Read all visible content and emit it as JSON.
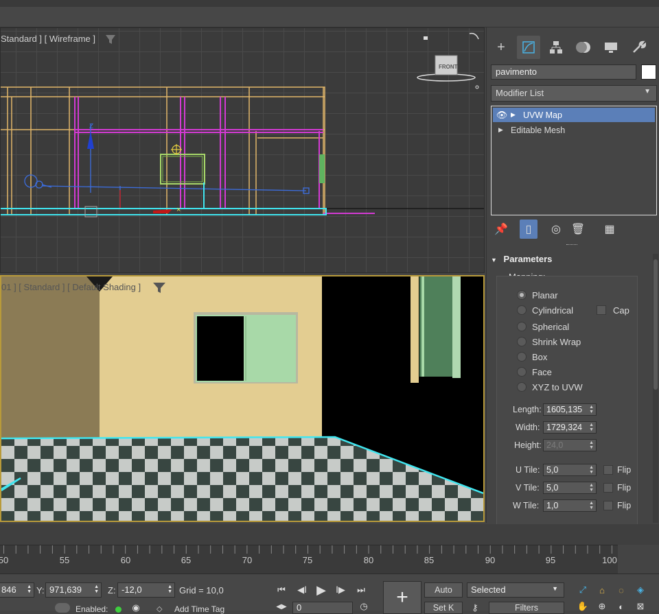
{
  "viewport_top": {
    "label": "Standard ] [ Wireframe ]",
    "viewcube_label": "FRONT"
  },
  "viewport_persp": {
    "label": "01 ] [ Standard ] [ Default Shading ]"
  },
  "command_panel": {
    "object_name": "pavimento",
    "object_color": "#ffffff",
    "modifier_list_label": "Modifier List",
    "stack": [
      {
        "label": "UVW Map",
        "selected": true
      },
      {
        "label": "Editable Mesh",
        "selected": false
      }
    ],
    "parameters": {
      "title": "Parameters",
      "mapping_label": "Mapping:",
      "options": [
        "Planar",
        "Cylindrical",
        "Spherical",
        "Shrink Wrap",
        "Box",
        "Face",
        "XYZ to UVW"
      ],
      "selected_option": "Planar",
      "cap_label": "Cap",
      "length_label": "Length:",
      "length_value": "1605,135",
      "width_label": "Width:",
      "width_value": "1729,324",
      "height_label": "Height:",
      "height_value": "24,0",
      "utile_label": "U Tile:",
      "utile_value": "5,0",
      "vtile_label": "V Tile:",
      "vtile_value": "5,0",
      "wtile_label": "W Tile:",
      "wtile_value": "1,0",
      "flip_label": "Flip"
    }
  },
  "timeline": {
    "ticks": [
      "50",
      "55",
      "60",
      "65",
      "70",
      "75",
      "80",
      "85",
      "90",
      "95",
      "100"
    ]
  },
  "status_bar": {
    "x_value": "846",
    "y_label": "Y:",
    "y_value": "971,639",
    "z_label": "Z:",
    "z_value": "-12,0",
    "grid_text": "Grid = 10,0",
    "frame_value": "0",
    "enabled_label": "Enabled:",
    "add_time_tag": "Add Time Tag",
    "auto_label": "Auto",
    "setk_label": "Set K",
    "selected_dropdown": "Selected",
    "filters_label": "Filters"
  },
  "colors": {
    "accent": "#5b7fb8",
    "wall": "#e3cd91",
    "cyan_edge": "#40e6f0",
    "window_green": "#a8d9a8"
  }
}
